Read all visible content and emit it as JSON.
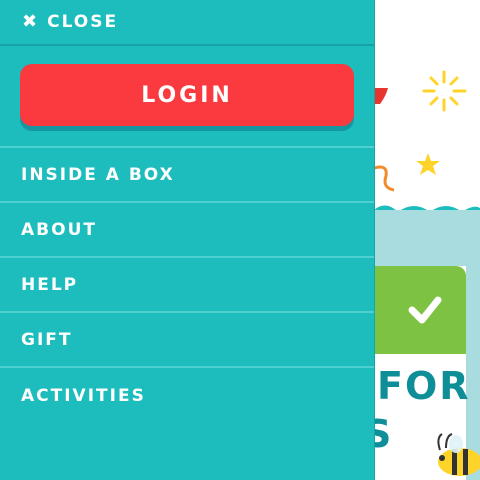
{
  "drawer": {
    "close_label": "CLOSE",
    "close_icon": "close-x-icon",
    "login_label": "LOGIN",
    "menu_items": [
      {
        "label": "INSIDE A BOX"
      },
      {
        "label": "ABOUT"
      },
      {
        "label": "HELP"
      },
      {
        "label": "GIFT"
      },
      {
        "label": "ACTIVITIES"
      }
    ]
  },
  "background_page": {
    "heading_fragment": "FOR",
    "heading_fragment_2": "S",
    "check_icon": "checkmark-icon"
  },
  "colors": {
    "drawer_bg": "#1ebdbd",
    "login_bg": "#fa3a3f",
    "divider": "#4fd0d0",
    "accent_green": "#7dc242",
    "heading_teal": "#0e8e97"
  }
}
